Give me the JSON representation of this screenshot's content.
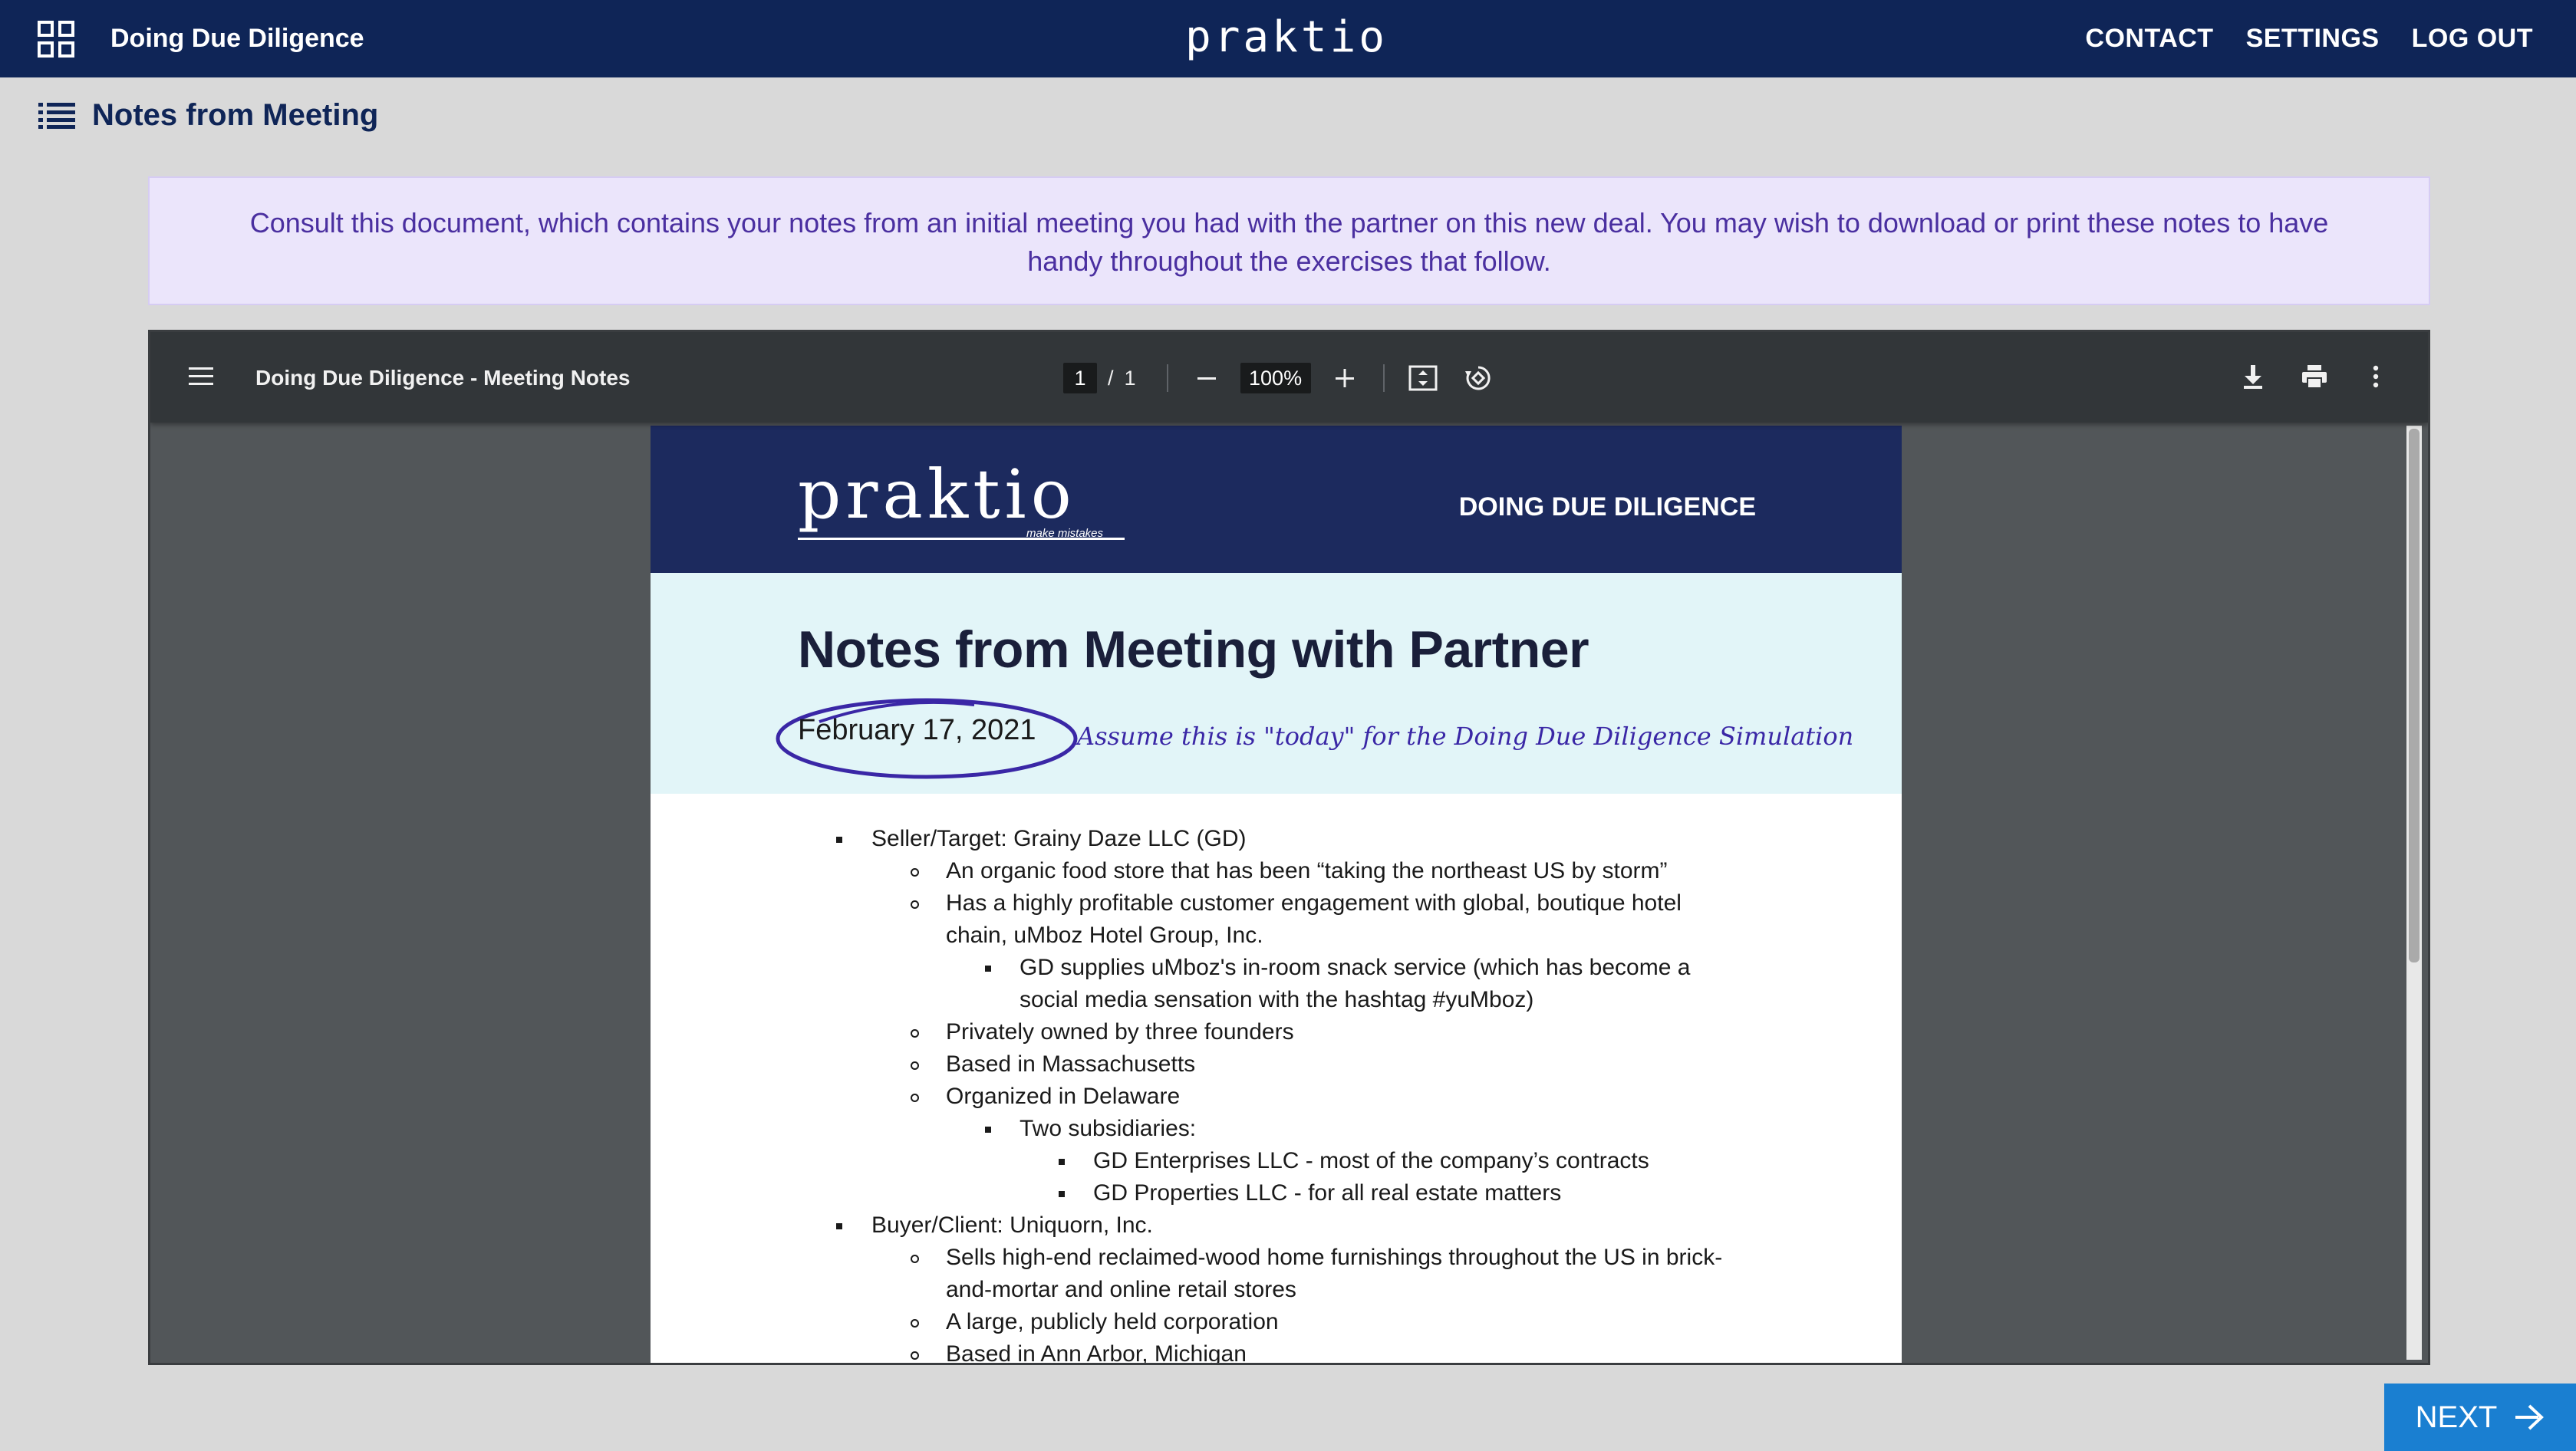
{
  "topnav": {
    "course_title": "Doing Due Diligence",
    "brand": "praktio",
    "links": {
      "contact": "CONTACT",
      "settings": "SETTINGS",
      "logout": "LOG OUT"
    }
  },
  "section": {
    "title": "Notes from Meeting"
  },
  "banner": {
    "text": "Consult this document, which contains your notes from an initial meeting you had with the partner on this new deal. You may wish to download or print these notes to have handy throughout the exercises that follow."
  },
  "viewer": {
    "title": "Doing Due Diligence - Meeting Notes",
    "page_current": "1",
    "page_separator": "/",
    "page_total": "1",
    "zoom": "100%"
  },
  "document": {
    "logo": "praktio",
    "tagline": "make mistakes",
    "course": "DOING DUE DILIGENCE",
    "title": "Notes from Meeting with Partner",
    "date": "February 17, 2021",
    "annotation": "Assume this is \"today\" for the Doing Due Diligence Simulation",
    "notes": [
      "Seller/Target: Grainy Daze LLC (GD)",
      "An organic food store that has been “taking the northeast US by storm”",
      "Has a highly profitable customer engagement with global, boutique hotel",
      "chain, uMboz Hotel Group, Inc.",
      "GD supplies uMboz's in-room snack service (which has become a",
      "social media sensation with the hashtag #yuMboz)",
      "Privately owned by three founders",
      "Based in Massachusetts",
      "Organized in Delaware",
      "Two subsidiaries:",
      "GD Enterprises LLC - most of the company’s contracts",
      "GD Properties LLC - for all real estate matters",
      "Buyer/Client: Uniquorn, Inc.",
      "Sells high-end reclaimed-wood home furnishings throughout the US in brick-",
      "and-mortar and online retail stores",
      "A large, publicly held corporation",
      "Based in Ann Arbor, Michigan"
    ]
  },
  "next_button": {
    "label": "NEXT"
  },
  "colors": {
    "nav": "#0f2557",
    "banner_bg": "#ebe5fb",
    "banner_text": "#4a2fa0",
    "next": "#1a7fd1"
  }
}
